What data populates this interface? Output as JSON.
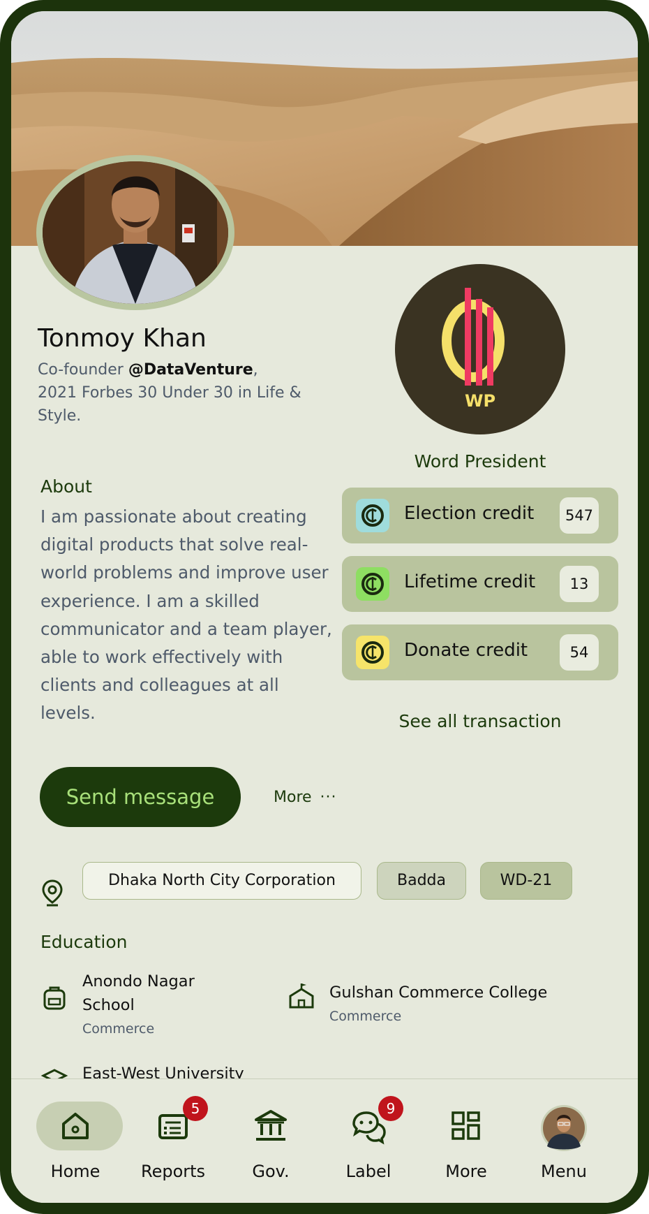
{
  "profile": {
    "name": "Tonmoy Khan",
    "bio_prefix": "Co-founder ",
    "bio_handle": "@DataVenture",
    "bio_suffix": ",",
    "bio_line2": "2021 Forbes 30 Under 30 in Life & Style."
  },
  "about": {
    "title": "About",
    "text": "I am passionate about creating digital products that solve real-world problems and improve user experience. I am a skilled communicator and a team player, able to work effectively with clients and colleagues at all levels."
  },
  "role": {
    "logo_text": "WP",
    "title": "Word President"
  },
  "credits": [
    {
      "label": "Election credit",
      "count": "547",
      "icon": "credit-coin-icon",
      "color": "#9fdcdc"
    },
    {
      "label": "Lifetime credit",
      "count": "13",
      "icon": "credit-coin-icon",
      "color": "#8ede62"
    },
    {
      "label": "Donate credit",
      "count": "54",
      "icon": "credit-coin-icon",
      "color": "#f6e46a"
    }
  ],
  "see_all": "See all transaction",
  "actions": {
    "send_message": "Send message",
    "more": "More",
    "more_dots": "···"
  },
  "location": {
    "icon": "location-pin-icon",
    "chips": [
      "Dhaka North City Corporation",
      "Badda",
      "WD-21"
    ]
  },
  "education": {
    "title": "Education",
    "items": [
      {
        "name_line1": "Anondo Nagar",
        "name_line2": "School",
        "sub": "Commerce",
        "icon": "backpack-icon"
      },
      {
        "name_line1": "Gulshan Commerce College",
        "sub": "Commerce",
        "icon": "school-building-icon"
      },
      {
        "name_line1": "East-West University",
        "icon": "graduation-icon"
      }
    ]
  },
  "nav": {
    "items": [
      {
        "label": "Home",
        "icon": "home-icon",
        "active": true
      },
      {
        "label": "Reports",
        "icon": "reports-icon",
        "badge": "5"
      },
      {
        "label": "Gov.",
        "icon": "government-icon"
      },
      {
        "label": "Label",
        "icon": "chat-icon",
        "badge": "9"
      },
      {
        "label": "More",
        "icon": "grid-icon"
      },
      {
        "label": "Menu",
        "icon": "avatar"
      }
    ]
  },
  "colors": {
    "frame": "#1c330c",
    "background": "#e6e9dc",
    "accent_dark": "#1c3a0c",
    "accent_light": "#a8e07a",
    "card": "#b9c49e",
    "badge": "#c0141c"
  }
}
